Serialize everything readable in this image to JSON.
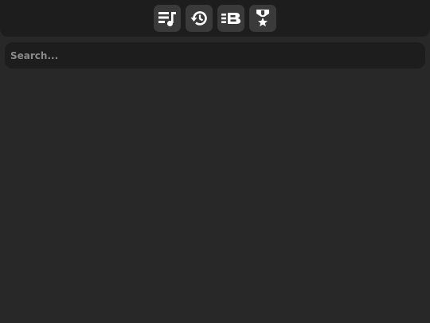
{
  "toolbar": {
    "buttons": [
      {
        "icon": "playlist-music-icon"
      },
      {
        "icon": "history-icon"
      },
      {
        "icon": "bandcamp-list-icon"
      },
      {
        "icon": "award-medal-icon"
      }
    ]
  },
  "search": {
    "placeholder": "Search...",
    "value": ""
  },
  "colors": {
    "background": "#282828",
    "panel": "#1d1d1d",
    "button": "#3a3a3a",
    "icon": "#ffffff"
  }
}
